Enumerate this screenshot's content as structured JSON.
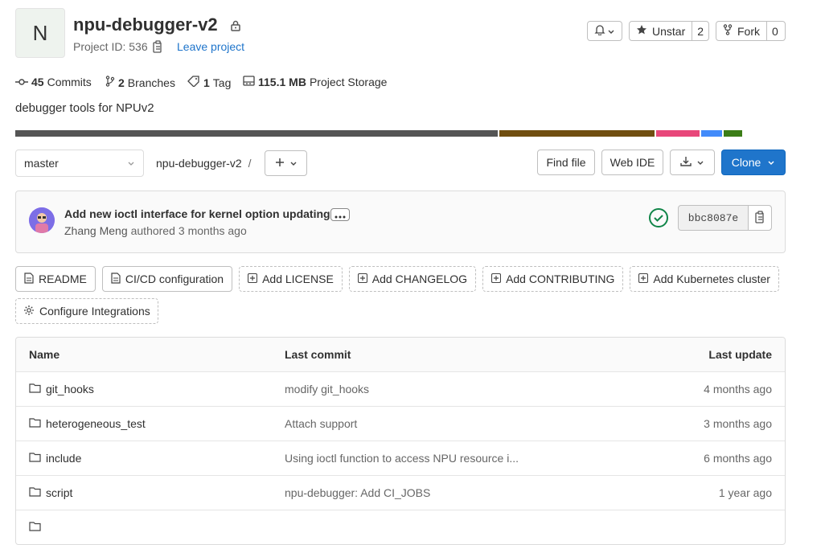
{
  "project": {
    "avatar_letter": "N",
    "title": "npu-debugger-v2",
    "id_text": "Project ID: 536",
    "leave_label": "Leave project"
  },
  "actions": {
    "unstar_label": "Unstar",
    "star_count": "2",
    "fork_label": "Fork",
    "fork_count": "0"
  },
  "stats": {
    "commits_count": "45",
    "commits_label": "Commits",
    "branches_count": "2",
    "branches_label": "Branches",
    "tags_count": "1",
    "tags_label": "Tag",
    "storage_value": "115.1 MB",
    "storage_label": "Project Storage"
  },
  "description": "debugger tools for NPUv2",
  "language_bar": {
    "colors": [
      "#555555",
      "#704e10",
      "#e8477a",
      "#428bfa",
      "#3b7d17"
    ]
  },
  "repo": {
    "branch": "master",
    "path": "npu-debugger-v2",
    "separator": "/",
    "find_file": "Find file",
    "web_ide": "Web IDE",
    "clone": "Clone"
  },
  "commit": {
    "message": "Add new ioctl interface for kernel option updating.",
    "author": "Zhang Meng",
    "authored_text": "authored",
    "time": "3 months ago",
    "sha": "bbc8087e",
    "status_color": "#108548"
  },
  "quick_links": [
    {
      "label": "README",
      "icon": "document-icon",
      "dashed": false
    },
    {
      "label": "CI/CD configuration",
      "icon": "document-icon",
      "dashed": false
    },
    {
      "label": "Add LICENSE",
      "icon": "plus-square-icon",
      "dashed": true
    },
    {
      "label": "Add CHANGELOG",
      "icon": "plus-square-icon",
      "dashed": true
    },
    {
      "label": "Add CONTRIBUTING",
      "icon": "plus-square-icon",
      "dashed": true
    },
    {
      "label": "Add Kubernetes cluster",
      "icon": "plus-square-icon",
      "dashed": true
    },
    {
      "label": "Configure Integrations",
      "icon": "gear-icon",
      "dashed": true
    }
  ],
  "table": {
    "headers": {
      "name": "Name",
      "last_commit": "Last commit",
      "last_update": "Last update"
    },
    "rows": [
      {
        "name": "git_hooks",
        "commit": "modify git_hooks",
        "update": "4 months ago"
      },
      {
        "name": "heterogeneous_test",
        "commit": "Attach support",
        "update": "3 months ago"
      },
      {
        "name": "include",
        "commit": "Using ioctl function to access NPU resource i...",
        "update": "6 months ago"
      },
      {
        "name": "script",
        "commit": "npu-debugger: Add CI_JOBS",
        "update": "1 year ago"
      }
    ]
  }
}
